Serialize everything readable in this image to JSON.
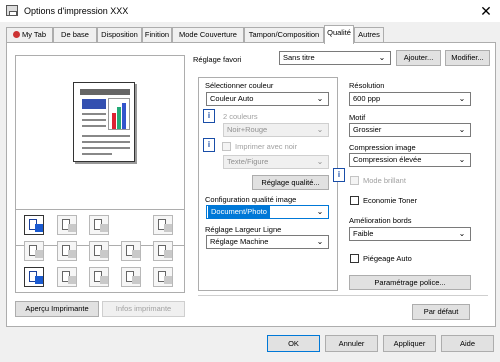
{
  "window": {
    "title": "Options d'impression XXX",
    "close_glyph": "✕"
  },
  "tabs": [
    {
      "label": "My Tab"
    },
    {
      "label": "De base"
    },
    {
      "label": "Disposition"
    },
    {
      "label": "Finition"
    },
    {
      "label": "Mode Couverture"
    },
    {
      "label": "Tampon/Composition"
    },
    {
      "label": "Qualité"
    },
    {
      "label": "Autres"
    }
  ],
  "favorites": {
    "label": "Réglage favori",
    "value": "Sans titre",
    "add_label": "Ajouter...",
    "modify_label": "Modifier..."
  },
  "preview": {
    "printer_view_label": "Aperçu Imprimante",
    "printer_info_label": "Infos imprimante"
  },
  "color": {
    "label": "Sélectionner couleur",
    "value": "Couleur Auto",
    "two_colors_label": "2 couleurs",
    "two_colors_value": "Noir+Rouge",
    "print_black_label": "Imprimer avec noir",
    "text_figure_value": "Texte/Figure",
    "quality_settings_label": "Réglage qualité..."
  },
  "image_config": {
    "label": "Configuration qualité image",
    "value": "Document/Photo"
  },
  "line_width": {
    "label": "Réglage Largeur Ligne",
    "value": "Réglage Machine"
  },
  "resolution": {
    "label": "Résolution",
    "value": "600 ppp"
  },
  "pattern": {
    "label": "Motif",
    "value": "Grossier"
  },
  "compression": {
    "label": "Compression image",
    "value": "Compression élevée"
  },
  "glossy_label": "Mode brillant",
  "toner_save_label": "Economie Toner",
  "edge_enhance": {
    "label": "Amélioration bords",
    "value": "Faible"
  },
  "trapping_label": "Piégeage Auto",
  "font_settings_label": "Paramétrage police...",
  "default_label": "Par défaut",
  "info_glyph": "i",
  "dropdown_glyph": "⌄",
  "dialog": {
    "ok": "OK",
    "cancel": "Annuler",
    "apply": "Appliquer",
    "help": "Aide"
  }
}
